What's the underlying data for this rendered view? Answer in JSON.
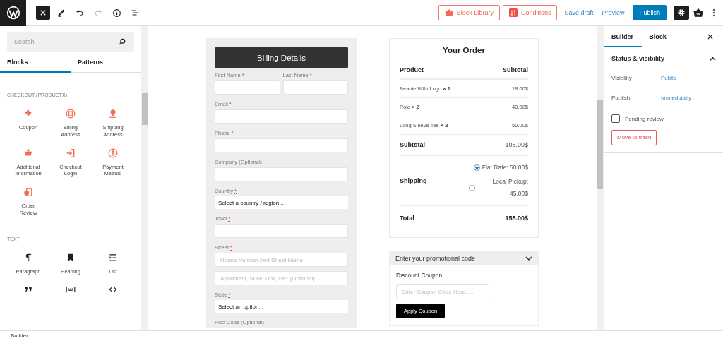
{
  "toolbar": {
    "actions": [
      {
        "label": "Block Library",
        "kind": "library"
      },
      {
        "label": "Conditions",
        "kind": "conditions"
      }
    ],
    "save_draft": "Save draft",
    "preview": "Preview",
    "publish": "Publish"
  },
  "inserter": {
    "search": {
      "placeholder": "Search"
    },
    "tabs": [
      {
        "label": "Blocks",
        "selected": true
      },
      {
        "label": "Patterns",
        "selected": false
      }
    ],
    "sections": [
      {
        "title": "CHECKOUT (PRODUCTX)",
        "items": [
          {
            "label": "Coupon",
            "kind": "coupon"
          },
          {
            "label": "Billing Address",
            "kind": "billing"
          },
          {
            "label": "Shipping Address",
            "kind": "pin"
          },
          {
            "label": "Additional Information",
            "kind": "cart"
          },
          {
            "label": "Checkout Login",
            "kind": "login"
          },
          {
            "label": "Payment Method",
            "kind": "dollar"
          },
          {
            "label": "Order Review",
            "kind": "review"
          }
        ]
      },
      {
        "title": "TEXT",
        "items": [
          {
            "label": "Paragraph",
            "kind": "paragraph"
          },
          {
            "label": "Heading",
            "kind": "heading"
          },
          {
            "label": "List",
            "kind": "list"
          },
          {
            "kind": "quote"
          },
          {
            "kind": "keyboard"
          },
          {
            "kind": "code"
          }
        ]
      }
    ]
  },
  "billing": {
    "title": "Billing Details",
    "fields": [
      {
        "kind": "pair",
        "items": [
          {
            "label": "First Name",
            "required_mark": "*"
          },
          {
            "label": "Last Name",
            "required_mark": "*"
          }
        ]
      },
      {
        "kind": "input",
        "label": "Email",
        "required_mark": "*"
      },
      {
        "kind": "input",
        "label": "Phone",
        "required_mark": "*"
      },
      {
        "kind": "input",
        "label": "Company (Optional)"
      },
      {
        "kind": "select",
        "label": "Country",
        "required_mark": "*",
        "value": "Select a country / region..."
      },
      {
        "kind": "input",
        "label": "Town",
        "required_mark": "*"
      },
      {
        "kind": "street",
        "label": "Street",
        "required_mark": "*",
        "placeholders": [
          "House Number And Street Name",
          "Apartment, Suite, Unit, Etc. (Optional)"
        ]
      },
      {
        "kind": "select",
        "label": "State",
        "required_mark": "*",
        "value": "Select an option..."
      },
      {
        "kind": "label",
        "label": "Post Code (Optional)"
      }
    ]
  },
  "order": {
    "title": "Your Order",
    "columns": [
      "Product",
      "Subtotal"
    ],
    "items": [
      {
        "name": "Beanie With Logo ",
        "qty": "× 1",
        "price": "18.00$"
      },
      {
        "name": "Polo ",
        "qty": "× 2",
        "price": "40.00$"
      },
      {
        "name": "Long Sleeve Tee ",
        "qty": "× 2",
        "price": "50.00$"
      }
    ],
    "subtotal": {
      "label": "Subtotal",
      "value": "108.00$"
    },
    "shipping": {
      "label": "Shipping",
      "options": [
        {
          "label": "Flat Rate: 50.00$",
          "selected": true
        },
        {
          "label": "Local Pickup: 45.00$",
          "selected": false
        }
      ]
    },
    "total": {
      "label": "Total",
      "value": "158.00$"
    }
  },
  "coupon": {
    "header": "Enter your promotional code",
    "expanded": true,
    "label": "Discount Coupon",
    "placeholder": "Enter Coupon Code Here.....",
    "button": "Apply Coupon"
  },
  "settings": {
    "tabs": [
      {
        "label": "Builder",
        "selected": true
      },
      {
        "label": "Block",
        "selected": false
      }
    ],
    "panel": {
      "title": "Status & visibility",
      "expanded": true,
      "rows": [
        {
          "label": "Visibility",
          "value": "Public"
        },
        {
          "label": "Publish",
          "value": "Immediately"
        }
      ],
      "pending": {
        "label": "Pending review",
        "checked": false
      },
      "trash": "Move to trash"
    }
  },
  "status_bar": "Builder"
}
